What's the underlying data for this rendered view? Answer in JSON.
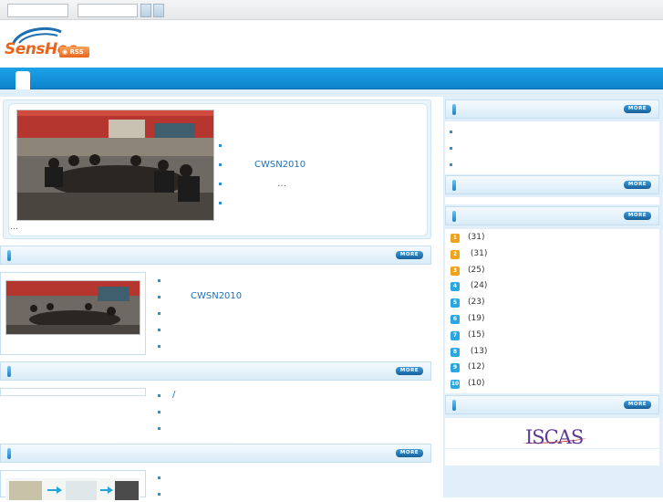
{
  "header": {
    "logo_text": "SensHoc",
    "rss_label": "RSS"
  },
  "feature": {
    "items": [
      "",
      "CWSN2010",
      "…",
      ""
    ],
    "ellipsis": "…"
  },
  "news": {
    "more_label": "MORE",
    "items": [
      "",
      "CWSN2010",
      "",
      "",
      ""
    ]
  },
  "section2": {
    "more_label": "MORE",
    "items": [
      "/",
      "",
      ""
    ]
  },
  "section3": {
    "more_label": "MORE",
    "items": [
      "",
      ""
    ]
  },
  "right": {
    "panel1": {
      "more_label": "MORE",
      "items": [
        "",
        "",
        ""
      ]
    },
    "panel2": {
      "more_label": "MORE"
    },
    "panel3": {
      "more_label": "MORE",
      "categories": [
        {
          "icon": "1",
          "color": "#f0a31a",
          "count": "(31)"
        },
        {
          "icon": "2",
          "color": "#f0a31a",
          "count": " (31)"
        },
        {
          "icon": "3",
          "color": "#f0a31a",
          "count": "(25)"
        },
        {
          "icon": "4",
          "color": "#2aa6e2",
          "count": " (24)"
        },
        {
          "icon": "5",
          "color": "#2aa6e2",
          "count": "(23)"
        },
        {
          "icon": "6",
          "color": "#2aa6e2",
          "count": "(19)"
        },
        {
          "icon": "7",
          "color": "#2aa6e2",
          "count": "(15)"
        },
        {
          "icon": "8",
          "color": "#2aa6e2",
          "count": " (13)"
        },
        {
          "icon": "9",
          "color": "#2aa6e2",
          "count": "(12)"
        },
        {
          "icon": "10",
          "color": "#2aa6e2",
          "count": "(10)"
        }
      ]
    },
    "panel4": {
      "more_label": "MORE",
      "logo_text": "ISCAS"
    }
  }
}
